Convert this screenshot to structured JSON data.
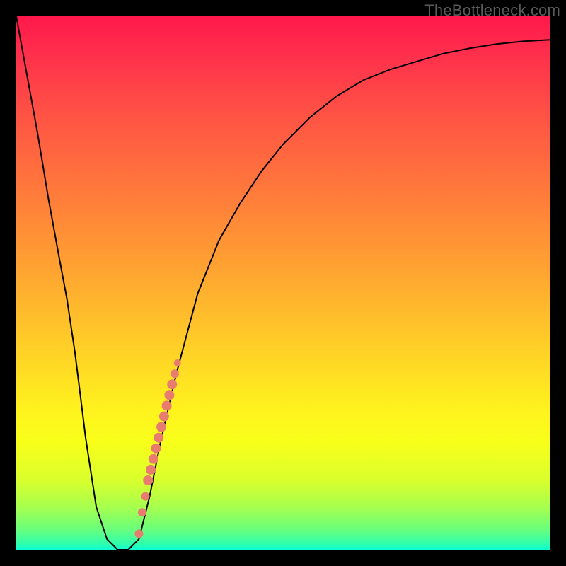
{
  "attribution": "TheBottleneck.com",
  "chart_data": {
    "type": "line",
    "title": "",
    "xlabel": "",
    "ylabel": "",
    "xlim": [
      0,
      100
    ],
    "ylim": [
      0,
      100
    ],
    "grid": false,
    "series": [
      {
        "name": "bottleneck-curve",
        "x": [
          0,
          2,
          4,
          6,
          8,
          9.5,
          11,
          12,
          13,
          15,
          17,
          19,
          21,
          23,
          25,
          27,
          30,
          34,
          38,
          42,
          46,
          50,
          55,
          60,
          65,
          70,
          75,
          80,
          85,
          90,
          95,
          100
        ],
        "y": [
          100,
          89,
          78,
          66,
          55,
          47,
          37,
          29,
          21,
          8,
          2,
          0,
          0,
          2,
          10,
          20,
          33,
          48,
          58,
          65,
          71,
          76,
          81,
          85,
          88,
          90,
          91.5,
          93,
          94,
          94.8,
          95.3,
          95.6
        ],
        "color": "#000000",
        "stroke_width": 2
      }
    ],
    "markers": {
      "name": "highlight-points",
      "color": "#e77c6f",
      "points": [
        {
          "x": 23.0,
          "y": 3,
          "r": 6
        },
        {
          "x": 23.6,
          "y": 7,
          "r": 6
        },
        {
          "x": 24.2,
          "y": 10,
          "r": 6
        },
        {
          "x": 24.7,
          "y": 13,
          "r": 7
        },
        {
          "x": 25.2,
          "y": 15,
          "r": 7
        },
        {
          "x": 25.7,
          "y": 17,
          "r": 7
        },
        {
          "x": 26.2,
          "y": 19,
          "r": 7
        },
        {
          "x": 26.7,
          "y": 21,
          "r": 7
        },
        {
          "x": 27.2,
          "y": 23,
          "r": 7
        },
        {
          "x": 27.7,
          "y": 25,
          "r": 7
        },
        {
          "x": 28.2,
          "y": 27,
          "r": 7
        },
        {
          "x": 28.7,
          "y": 29,
          "r": 7
        },
        {
          "x": 29.2,
          "y": 31,
          "r": 7
        },
        {
          "x": 29.7,
          "y": 33,
          "r": 6
        },
        {
          "x": 30.2,
          "y": 35,
          "r": 5
        }
      ]
    }
  }
}
